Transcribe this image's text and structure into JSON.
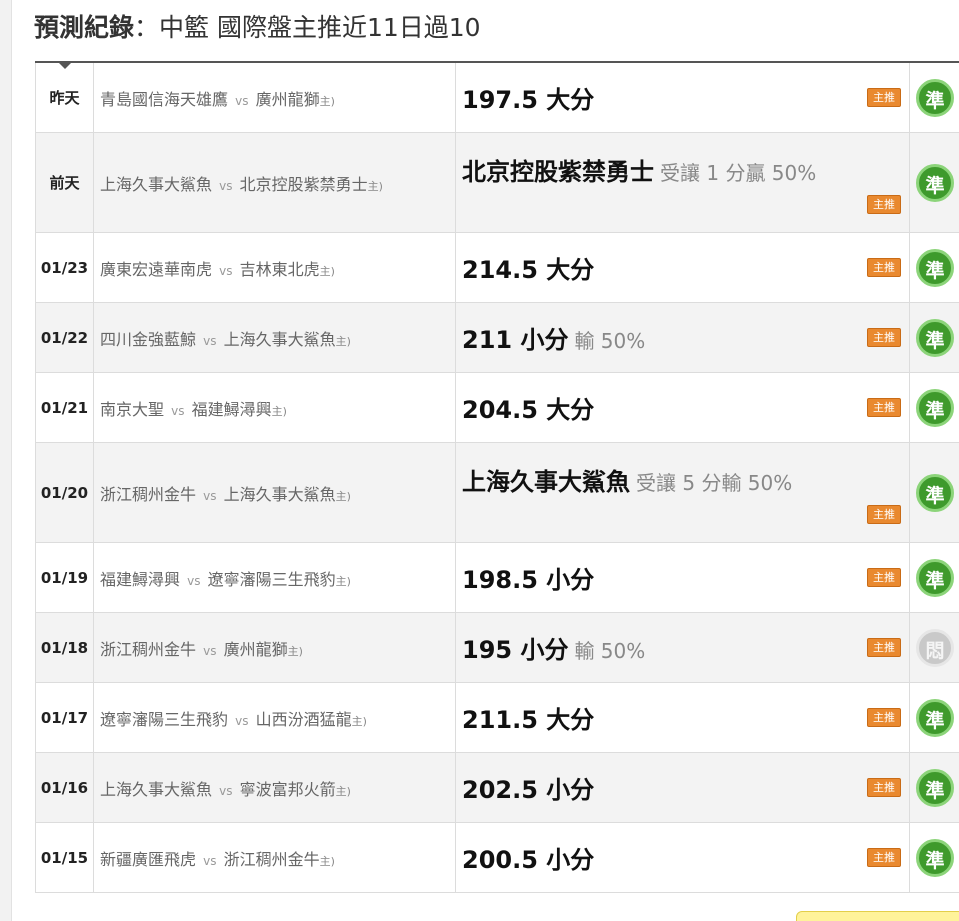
{
  "header": {
    "title_label": "預測紀錄",
    "title_rest": "：中籃 國際盤主推近11日過10"
  },
  "labels": {
    "vs": "vs",
    "host_mark": "主)",
    "badge": "主推"
  },
  "records": [
    {
      "date": "昨天",
      "away": "青島國信海天雄鷹",
      "home": "廣州龍獅",
      "pick": "197.5 大分",
      "extra": "",
      "badge_below": false,
      "result": "準",
      "result_type": "win"
    },
    {
      "date": "前天",
      "away": "上海久事大鯊魚",
      "home": "北京控股紫禁勇士",
      "pick": "北京控股紫禁勇士",
      "extra": "受讓 1 分贏 50%",
      "badge_below": true,
      "result": "準",
      "result_type": "win"
    },
    {
      "date": "01/23",
      "away": "廣東宏遠華南虎",
      "home": "吉林東北虎",
      "pick": "214.5 大分",
      "extra": "",
      "badge_below": false,
      "result": "準",
      "result_type": "win"
    },
    {
      "date": "01/22",
      "away": "四川金強藍鯨",
      "home": "上海久事大鯊魚",
      "pick": "211 小分",
      "extra": "輸 50%",
      "badge_below": false,
      "result": "準",
      "result_type": "win"
    },
    {
      "date": "01/21",
      "away": "南京大聖",
      "home": "福建鱘潯興",
      "pick": "204.5 大分",
      "extra": "",
      "badge_below": false,
      "result": "準",
      "result_type": "win"
    },
    {
      "date": "01/20",
      "away": "浙江稠州金牛",
      "home": "上海久事大鯊魚",
      "pick": "上海久事大鯊魚",
      "extra": "受讓 5 分輸 50%",
      "badge_below": true,
      "result": "準",
      "result_type": "win"
    },
    {
      "date": "01/19",
      "away": "福建鱘潯興",
      "home": "遼寧瀋陽三生飛豹",
      "pick": "198.5 小分",
      "extra": "",
      "badge_below": false,
      "result": "準",
      "result_type": "win"
    },
    {
      "date": "01/18",
      "away": "浙江稠州金牛",
      "home": "廣州龍獅",
      "pick": "195 小分",
      "extra": "輸 50%",
      "badge_below": false,
      "result": "悶",
      "result_type": "lose"
    },
    {
      "date": "01/17",
      "away": "遼寧瀋陽三生飛豹",
      "home": "山西汾酒猛龍",
      "pick": "211.5 大分",
      "extra": "",
      "badge_below": false,
      "result": "準",
      "result_type": "win"
    },
    {
      "date": "01/16",
      "away": "上海久事大鯊魚",
      "home": "寧波富邦火箭",
      "pick": "202.5 小分",
      "extra": "",
      "badge_below": false,
      "result": "準",
      "result_type": "win"
    },
    {
      "date": "01/15",
      "away": "新疆廣匯飛虎",
      "home": "浙江稠州金牛",
      "pick": "200.5 小分",
      "extra": "",
      "badge_below": false,
      "result": "準",
      "result_type": "win"
    }
  ],
  "colors": {
    "badge": "#e9892f",
    "win": "#3e9a2c",
    "lose": "#c9c9c9"
  }
}
